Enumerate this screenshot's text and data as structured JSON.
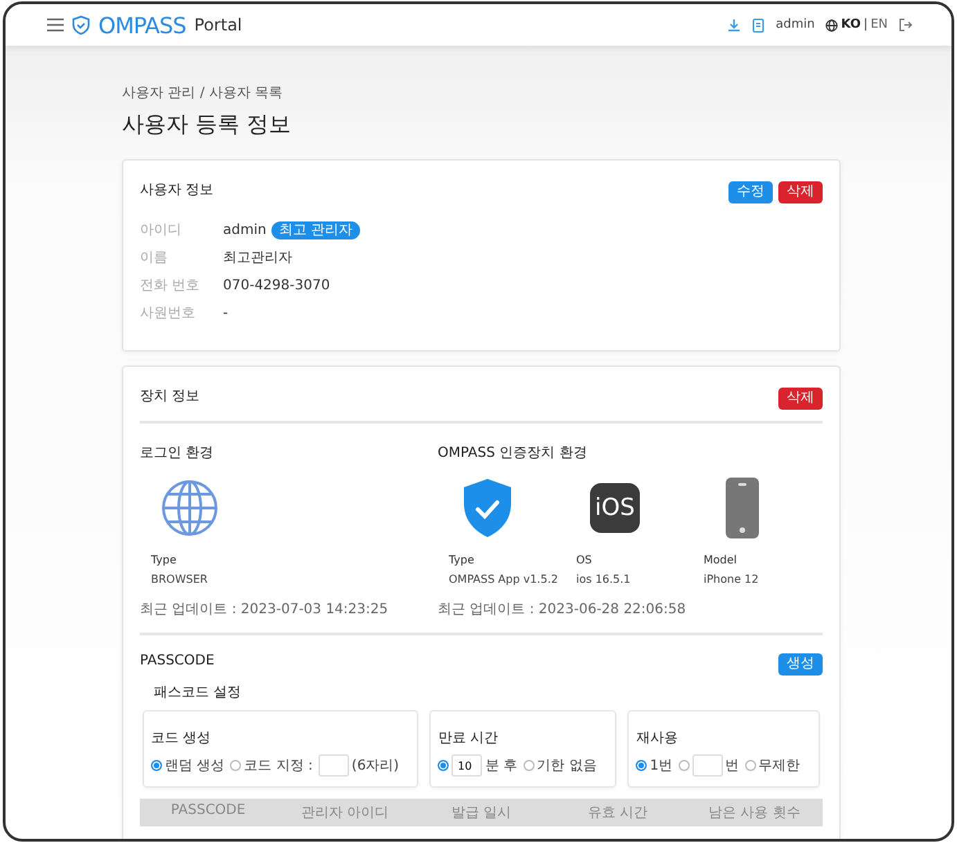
{
  "header": {
    "brand": "OMPASS",
    "product": "Portal",
    "user": "admin",
    "languages": [
      {
        "label": "KO",
        "selected": true
      },
      {
        "label": "EN",
        "selected": false
      }
    ],
    "language_separator": "|"
  },
  "breadcrumb": "사용자 관리 / 사용자 목록",
  "page_title": "사용자 등록 정보",
  "user_info": {
    "title": "사용자 정보",
    "buttons": [
      {
        "label": "수정",
        "kind": "primary"
      },
      {
        "label": "삭제",
        "kind": "danger"
      }
    ],
    "fields": [
      {
        "label": "아이디",
        "value": "admin",
        "badge": "최고 관리자"
      },
      {
        "label": "이름",
        "value": "최고관리자"
      },
      {
        "label": "전화 번호",
        "value": "070-4298-3070"
      },
      {
        "label": "사원번호",
        "value": "-"
      }
    ]
  },
  "device_info": {
    "title": "장치 정보",
    "buttons": [
      {
        "label": "삭제",
        "kind": "danger"
      }
    ],
    "login_env": {
      "title": "로그인 환경",
      "items": [
        {
          "kind": "globe",
          "label": "Type",
          "value": "BROWSER"
        }
      ],
      "updated": "최근 업데이트 : 2023-07-03 14:23:25"
    },
    "auth_env": {
      "title": "OMPASS 인증장치 환경",
      "items": [
        {
          "kind": "shield",
          "label": "Type",
          "value": "OMPASS App v1.5.2"
        },
        {
          "kind": "ios",
          "icon_text": "iOS",
          "label": "OS",
          "value": "ios 16.5.1"
        },
        {
          "kind": "phone",
          "label": "Model",
          "value": "iPhone 12"
        }
      ],
      "updated": "최근 업데이트 : 2023-06-28 22:06:58"
    },
    "passcode": {
      "title": "PASSCODE",
      "buttons": [
        {
          "label": "생성",
          "kind": "primary"
        }
      ],
      "settings_title": "패스코드 설정",
      "groups": [
        {
          "title": "코드 생성",
          "options": [
            {
              "kind": "radio",
              "label": "랜덤 생성",
              "selected": true
            },
            {
              "kind": "radio",
              "label": "코드 지정 :",
              "selected": false
            },
            {
              "kind": "input"
            },
            {
              "kind": "text",
              "label": "(6자리)"
            }
          ]
        },
        {
          "title": "만료 시간",
          "options": [
            {
              "kind": "radio",
              "selected": true
            },
            {
              "kind": "input",
              "value": "10"
            },
            {
              "kind": "text",
              "label": "분 후"
            },
            {
              "kind": "radio",
              "label": "기한 없음",
              "selected": false
            }
          ]
        },
        {
          "title": "재사용",
          "options": [
            {
              "kind": "radio",
              "label": "1번",
              "selected": true
            },
            {
              "kind": "radio",
              "selected": false
            },
            {
              "kind": "input"
            },
            {
              "kind": "text",
              "label": "번"
            },
            {
              "kind": "radio",
              "label": "무제한",
              "selected": false
            }
          ]
        }
      ],
      "table": {
        "columns": [
          "PASSCODE",
          "관리자 아이디",
          "발급 일시",
          "유효 시간",
          "남은 사용 횟수"
        ]
      }
    }
  }
}
